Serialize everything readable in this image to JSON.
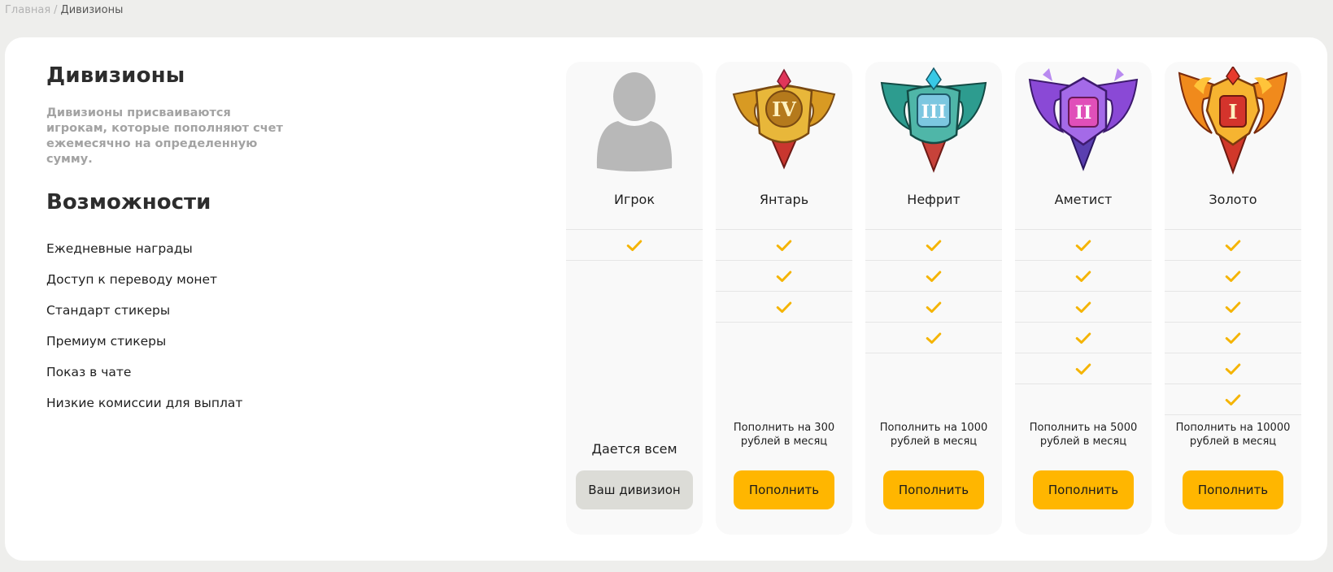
{
  "breadcrumb": {
    "home": "Главная",
    "separator": "/",
    "current": "Дивизионы"
  },
  "intro": {
    "title": "Дивизионы",
    "description": "Дивизионы присваиваются игрокам, которые пополняют счет ежемесячно на определенную сумму."
  },
  "features": {
    "title": "Возможности",
    "items": [
      "Ежедневные награды",
      "Доступ к переводу монет",
      "Стандарт стикеры",
      "Премиум стикеры",
      "Показ в чате",
      "Низкие комиссии для выплат"
    ]
  },
  "colors": {
    "accent_button": "#ffb600",
    "current_button": "#dcdcd7",
    "check": "#f5b400"
  },
  "tiers": [
    {
      "name": "Игрок",
      "emblem": "player-silhouette-icon",
      "features_included": 1,
      "note": "Дается всем",
      "button": "Ваш дивизион"
    },
    {
      "name": "Янтарь",
      "emblem": "amber-emblem-icon",
      "rank": "IV",
      "features_included": 3,
      "price": "Пополнить на 300 рублей в месяц",
      "button": "Пополнить"
    },
    {
      "name": "Нефрит",
      "emblem": "jade-emblem-icon",
      "rank": "III",
      "features_included": 4,
      "price": "Пополнить на 1000 рублей в месяц",
      "button": "Пополнить"
    },
    {
      "name": "Аметист",
      "emblem": "amethyst-emblem-icon",
      "rank": "II",
      "features_included": 5,
      "price": "Пополнить на 5000 рублей в месяц",
      "button": "Пополнить"
    },
    {
      "name": "Золото",
      "emblem": "gold-emblem-icon",
      "rank": "I",
      "features_included": 6,
      "price": "Пополнить на 10000 рублей в месяц",
      "button": "Пополнить"
    }
  ]
}
